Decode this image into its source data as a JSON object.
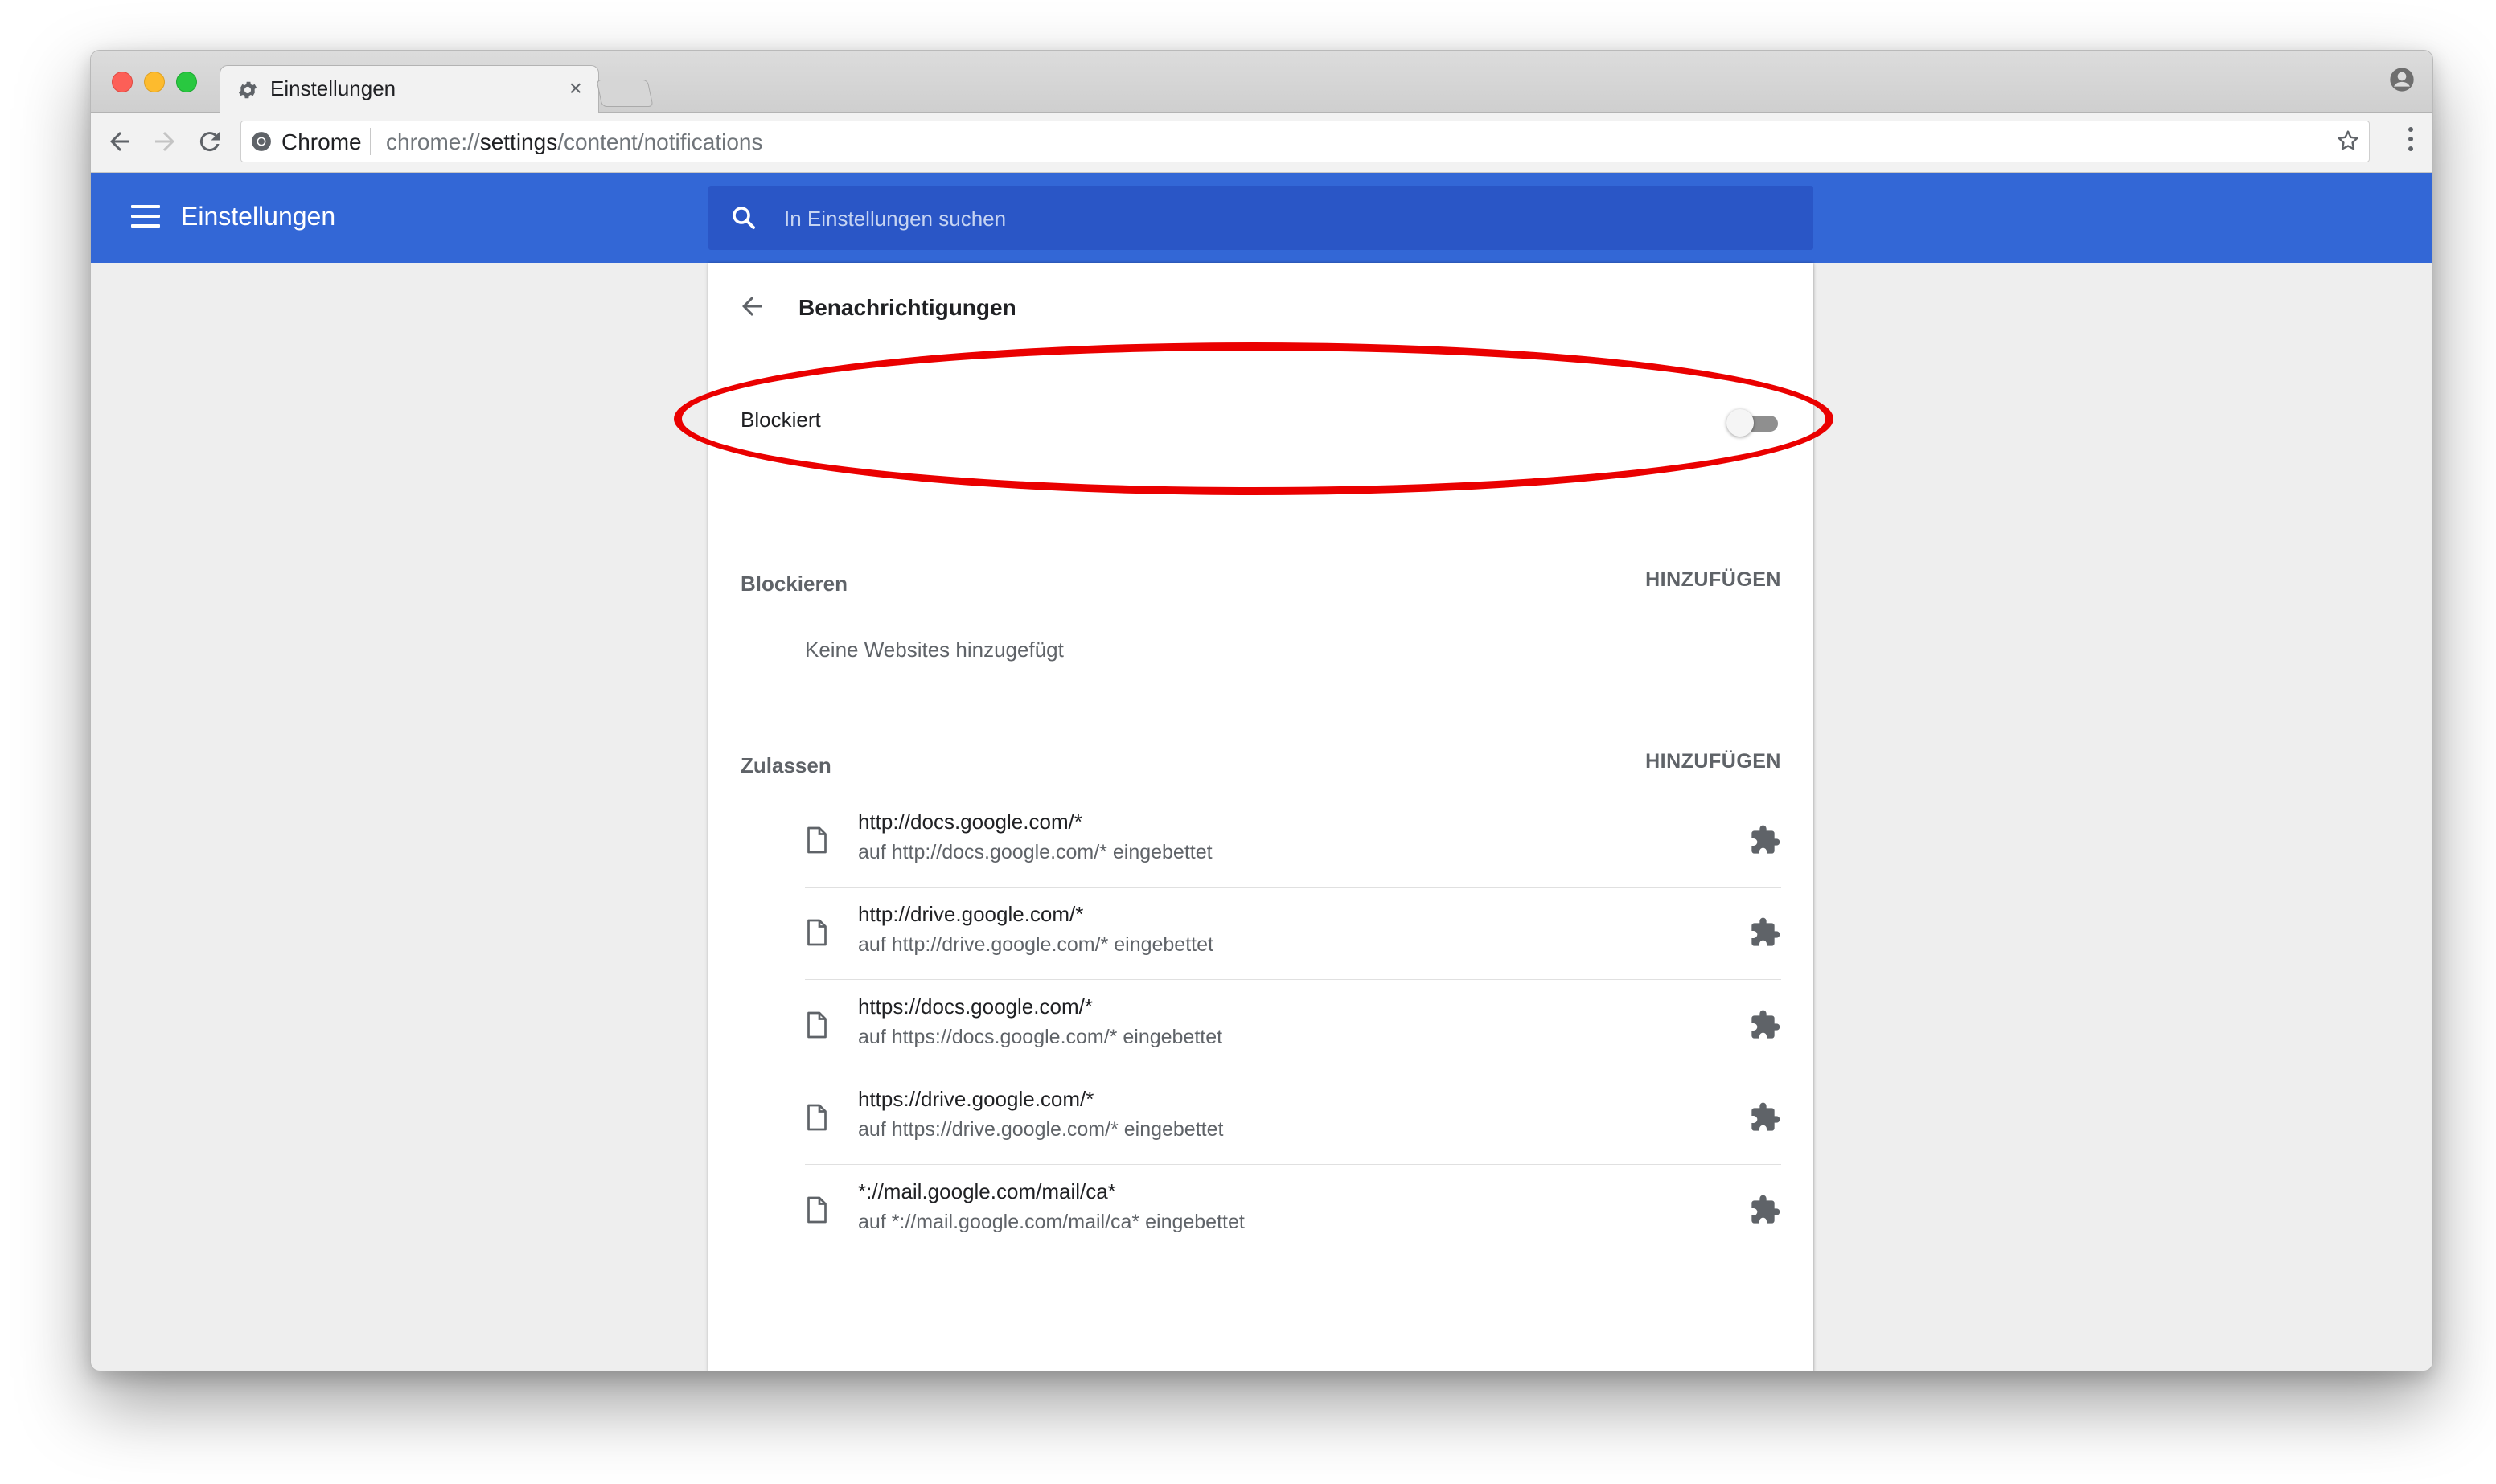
{
  "browser": {
    "tab_title": "Einstellungen",
    "tab_close": "×",
    "omnibox": {
      "scheme_label": "Chrome",
      "url_prefix": "chrome://",
      "url_host": "settings",
      "url_path": "/content/notifications"
    }
  },
  "appbar": {
    "title": "Einstellungen",
    "search_placeholder": "In Einstellungen suchen"
  },
  "page": {
    "title": "Benachrichtigungen",
    "toggle": {
      "label": "Blockiert",
      "state": "off"
    },
    "block_section": {
      "label": "Blockieren",
      "add_label": "HINZUFÜGEN",
      "empty_message": "Keine Websites hinzugefügt"
    },
    "allow_section": {
      "label": "Zulassen",
      "add_label": "HINZUFÜGEN",
      "sites": [
        {
          "url": "http://docs.google.com/*",
          "sub": "auf http://docs.google.com/* eingebettet",
          "icon": "puzzle-icon"
        },
        {
          "url": "http://drive.google.com/*",
          "sub": "auf http://drive.google.com/* eingebettet",
          "icon": "puzzle-icon"
        },
        {
          "url": "https://docs.google.com/*",
          "sub": "auf https://docs.google.com/* eingebettet",
          "icon": "puzzle-icon"
        },
        {
          "url": "https://drive.google.com/*",
          "sub": "auf https://drive.google.com/* eingebettet",
          "icon": "puzzle-icon"
        },
        {
          "url": "*://mail.google.com/mail/ca*",
          "sub": "auf *://mail.google.com/mail/ca* eingebettet",
          "icon": "puzzle-icon"
        }
      ]
    }
  },
  "colors": {
    "appbar": "#3367d6",
    "searchbar": "#2a56c6",
    "annotation": "#ea0000",
    "background": "#eeeeee"
  }
}
